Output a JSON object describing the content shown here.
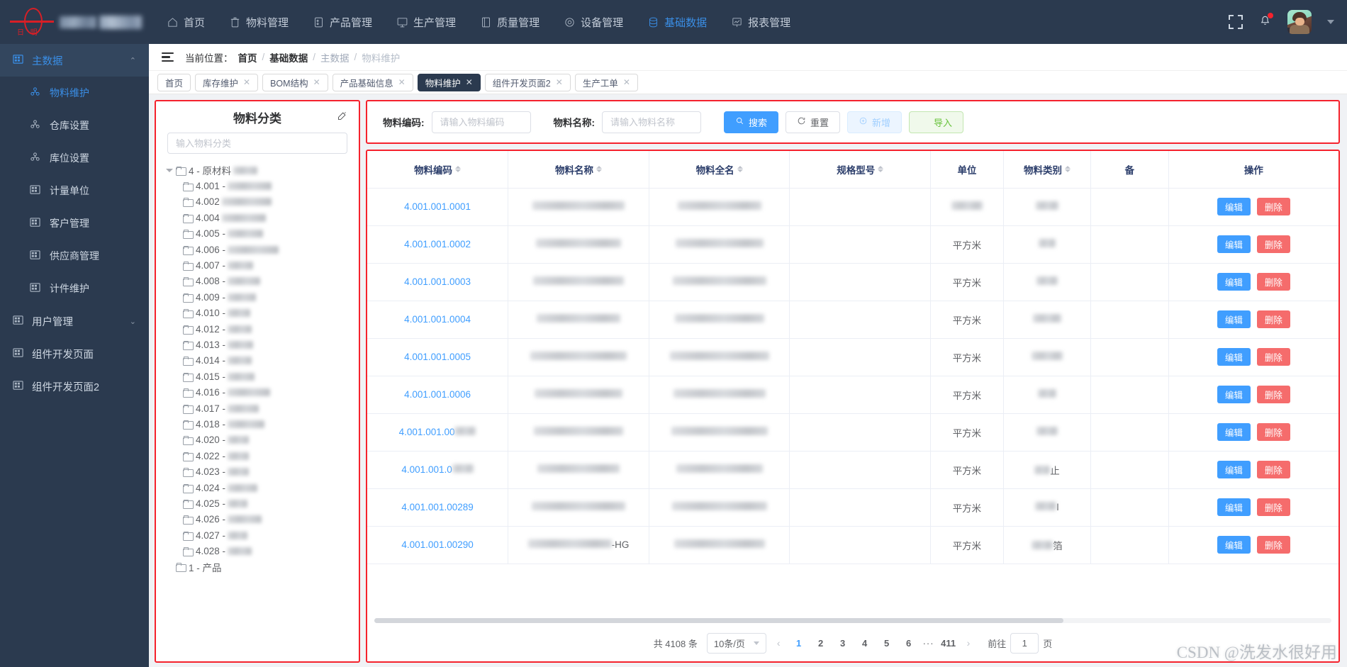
{
  "header": {
    "logo_text": "日 明",
    "nav": [
      {
        "label": "首页",
        "icon": "home-icon",
        "active": false
      },
      {
        "label": "物料管理",
        "icon": "box-icon",
        "active": false
      },
      {
        "label": "产品管理",
        "icon": "product-icon",
        "active": false
      },
      {
        "label": "生产管理",
        "icon": "monitor-icon",
        "active": false
      },
      {
        "label": "质量管理",
        "icon": "book-icon",
        "active": false
      },
      {
        "label": "设备管理",
        "icon": "gear-icon",
        "active": false
      },
      {
        "label": "基础数据",
        "icon": "database-icon",
        "active": true
      },
      {
        "label": "报表管理",
        "icon": "chart-icon",
        "active": false
      }
    ],
    "fullscreen_icon": "fullscreen-icon",
    "bell_icon": "bell-icon",
    "avatar_icon": "avatar",
    "caret_icon": "chevron-down-icon"
  },
  "sidebar": {
    "groups": [
      {
        "label": "主数据",
        "icon": "grid-icon",
        "active": true,
        "expanded": true,
        "chevron": "⌃",
        "items": [
          {
            "label": "物料维护",
            "icon": "node-icon",
            "active": true
          },
          {
            "label": "仓库设置",
            "icon": "node-icon",
            "active": false
          },
          {
            "label": "库位设置",
            "icon": "node-icon",
            "active": false
          },
          {
            "label": "计量单位",
            "icon": "grid-icon",
            "active": false
          },
          {
            "label": "客户管理",
            "icon": "grid-icon",
            "active": false
          },
          {
            "label": "供应商管理",
            "icon": "grid-icon",
            "active": false
          },
          {
            "label": "计件维护",
            "icon": "grid-icon",
            "active": false
          }
        ]
      },
      {
        "label": "用户管理",
        "icon": "grid-icon",
        "active": false,
        "expanded": false,
        "chevron": "⌄",
        "items": []
      }
    ],
    "standalone": [
      {
        "label": "组件开发页面",
        "icon": "grid-icon"
      },
      {
        "label": "组件开发页面2",
        "icon": "grid-icon"
      }
    ]
  },
  "breadcrumb": {
    "menu_icon": "hamburger-icon",
    "prefix": "当前位置：",
    "items": [
      "首页",
      "基础数据",
      "主数据",
      "物料维护"
    ],
    "separator": "/"
  },
  "tabs": [
    {
      "label": "首页",
      "closable": false,
      "active": false
    },
    {
      "label": "库存维护",
      "closable": true,
      "active": false
    },
    {
      "label": "BOM结构",
      "closable": true,
      "active": false
    },
    {
      "label": "产品基础信息",
      "closable": true,
      "active": false
    },
    {
      "label": "物料维护",
      "closable": true,
      "active": true
    },
    {
      "label": "组件开发页面2",
      "closable": true,
      "active": false
    },
    {
      "label": "生产工单",
      "closable": true,
      "active": false
    }
  ],
  "tree": {
    "title": "物料分类",
    "edit_icon": "edit-icon",
    "search_placeholder": "输入物料分类",
    "search_value": "",
    "nodes": [
      {
        "label": "4 - 原材料",
        "level": 0,
        "expanded": true,
        "blur": 34
      },
      {
        "label": "4.001 -",
        "level": 1,
        "blur": 62
      },
      {
        "label": "4.002",
        "level": 1,
        "blur": 70
      },
      {
        "label": "4.004",
        "level": 1,
        "blur": 62
      },
      {
        "label": "4.005 -",
        "level": 1,
        "blur": 50
      },
      {
        "label": "4.006 -",
        "level": 1,
        "blur": 72
      },
      {
        "label": "4.007 -",
        "level": 1,
        "blur": 36
      },
      {
        "label": "4.008 -",
        "level": 1,
        "blur": 46
      },
      {
        "label": "4.009 -",
        "level": 1,
        "blur": 40
      },
      {
        "label": "4.010 -",
        "level": 1,
        "blur": 32
      },
      {
        "label": "4.012 -",
        "level": 1,
        "blur": 34
      },
      {
        "label": "4.013 -",
        "level": 1,
        "blur": 36
      },
      {
        "label": "4.014 -",
        "level": 1,
        "blur": 34
      },
      {
        "label": "4.015 -",
        "level": 1,
        "blur": 38
      },
      {
        "label": "4.016 -",
        "level": 1,
        "blur": 60
      },
      {
        "label": "4.017 -",
        "level": 1,
        "blur": 44
      },
      {
        "label": "4.018 -",
        "level": 1,
        "blur": 52
      },
      {
        "label": "4.020 -",
        "level": 1,
        "blur": 30
      },
      {
        "label": "4.022 -",
        "level": 1,
        "blur": 30
      },
      {
        "label": "4.023 -",
        "level": 1,
        "blur": 30
      },
      {
        "label": "4.024 -",
        "level": 1,
        "blur": 42
      },
      {
        "label": "4.025 -",
        "level": 1,
        "blur": 28
      },
      {
        "label": "4.026 -",
        "level": 1,
        "blur": 48
      },
      {
        "label": "4.027 -",
        "level": 1,
        "blur": 28
      },
      {
        "label": "4.028 -",
        "level": 1,
        "blur": 34
      },
      {
        "label": "1 - 产品",
        "level": 0,
        "expanded": false,
        "blur": 0
      }
    ]
  },
  "filter": {
    "code_label": "物料编码:",
    "code_placeholder": "请输入物料编码",
    "code_value": "",
    "name_label": "物料名称:",
    "name_placeholder": "请输入物料名称",
    "name_value": "",
    "buttons": [
      {
        "label": "搜索",
        "icon": "search-icon",
        "style": "primary"
      },
      {
        "label": "重置",
        "icon": "refresh-icon",
        "style": "default"
      },
      {
        "label": "新增",
        "icon": "plus-circle-icon",
        "style": "disabled"
      },
      {
        "label": "导入",
        "icon": "cloud-upload-icon",
        "style": "success"
      }
    ]
  },
  "table": {
    "columns": [
      {
        "label": "物料编码",
        "sortable": true
      },
      {
        "label": "物料名称",
        "sortable": true
      },
      {
        "label": "物料全名",
        "sortable": true
      },
      {
        "label": "规格型号",
        "sortable": true
      },
      {
        "label": "单位",
        "sortable": false
      },
      {
        "label": "物料类别",
        "sortable": true
      },
      {
        "label": "备",
        "sortable": false
      },
      {
        "label": "操作",
        "sortable": false
      }
    ],
    "edit_label": "编辑",
    "delete_label": "删除",
    "rows": [
      {
        "code": "4.001.001.0001",
        "name_blur": 130,
        "full_blur": 118,
        "spec_blur": 0,
        "unit": "平方米",
        "unit_blur": true,
        "cat_blur": 32
      },
      {
        "code": "4.001.001.0002",
        "name_blur": 120,
        "full_blur": 124,
        "spec_blur": 0,
        "unit": "平方米",
        "unit_blur": false,
        "cat_blur": 24
      },
      {
        "code": "4.001.001.0003",
        "name_blur": 128,
        "full_blur": 132,
        "spec_blur": 0,
        "unit": "平方米",
        "unit_blur": false,
        "cat_blur": 30
      },
      {
        "code": "4.001.001.0004",
        "name_blur": 118,
        "full_blur": 126,
        "spec_blur": 0,
        "unit": "平方米",
        "unit_blur": false,
        "cat_blur": 40
      },
      {
        "code": "4.001.001.0005",
        "name_blur": 136,
        "full_blur": 140,
        "spec_blur": 0,
        "unit": "平方米",
        "unit_blur": false,
        "cat_blur": 44
      },
      {
        "code": "4.001.001.0006",
        "name_blur": 124,
        "full_blur": 130,
        "spec_blur": 0,
        "unit": "平方米",
        "unit_blur": false,
        "cat_blur": 26
      },
      {
        "code": "4.001.001.00",
        "code_blur": true,
        "name_blur": 126,
        "full_blur": 136,
        "spec_blur": 0,
        "unit": "平方米",
        "unit_blur": false,
        "cat_blur": 30
      },
      {
        "code": "4.001.001.0",
        "code_blur": true,
        "name_blur": 116,
        "full_blur": 122,
        "spec_blur": 0,
        "unit": "平方米",
        "unit_blur": false,
        "cat_blur": 22,
        "cat_text": "止"
      },
      {
        "code": "4.001.001.00289",
        "name_blur": 132,
        "full_blur": 134,
        "spec_blur": 0,
        "unit": "平方米",
        "unit_blur": false,
        "cat_blur": 30,
        "cat_text": "I"
      },
      {
        "code": "4.001.001.00290",
        "name_blur": 118,
        "name_text": "-HG",
        "full_blur": 128,
        "spec_blur": 0,
        "unit": "平方米",
        "unit_blur": false,
        "cat_blur": 30,
        "cat_text": "箔"
      }
    ]
  },
  "pagination": {
    "total_text": "共 4108 条",
    "page_size": "10条/页",
    "prev_icon": "chevron-left-icon",
    "next_icon": "chevron-right-icon",
    "pages": [
      "1",
      "2",
      "3",
      "4",
      "5",
      "6"
    ],
    "ellipsis": "···",
    "last_page": "411",
    "current_page": "1",
    "jump_prefix": "前往",
    "jump_value": "1",
    "jump_suffix": "页"
  },
  "watermark": "CSDN @洗发水很好用",
  "colors": {
    "header_bg": "#2b3a4f",
    "accent": "#409eff",
    "danger": "#f56c6c",
    "highlight_border": "#f5222d",
    "success": "#67c23a"
  }
}
